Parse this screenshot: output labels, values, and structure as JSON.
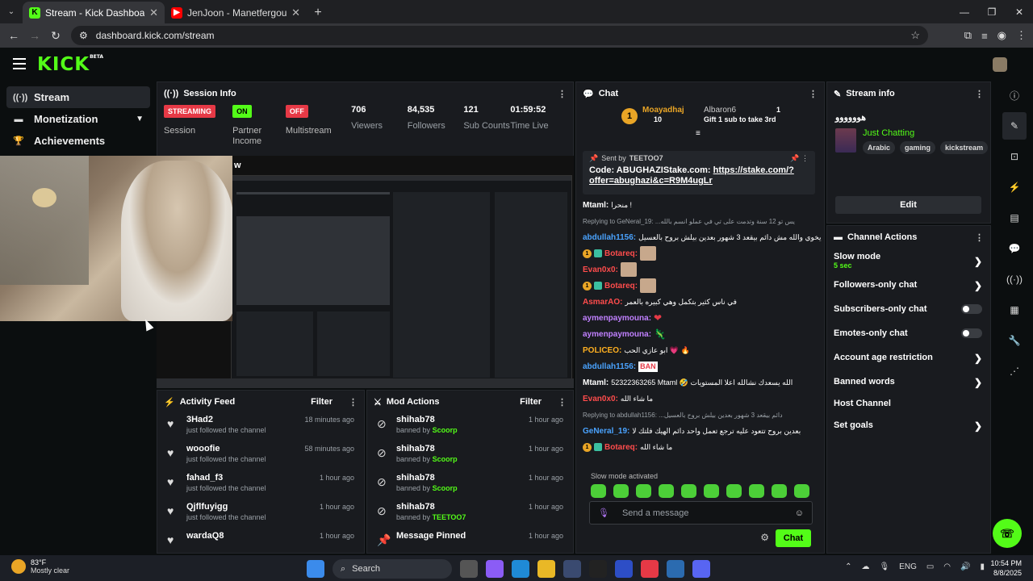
{
  "browser": {
    "tabs": [
      {
        "title": "Stream - Kick Dashboard",
        "favicon": "K"
      },
      {
        "title": "JenJoon - Manetfergou | ...",
        "favicon": "▶"
      }
    ],
    "url": "dashboard.kick.com/stream"
  },
  "kick": {
    "logo": "KICK",
    "logo_sup": "BETA"
  },
  "leftnav": [
    {
      "label": "Stream",
      "icon": "((·))"
    },
    {
      "label": "Monetization",
      "icon": "▬"
    },
    {
      "label": "Achievements",
      "icon": "🏆"
    }
  ],
  "session": {
    "title": "Session Info",
    "streaming_badge": "STREAMING",
    "streaming_label": "Session",
    "on_badge": "ON",
    "on_label": "Partner Income",
    "off_badge": "OFF",
    "off_label": "Multistream",
    "viewers": "706",
    "viewers_label": "Viewers",
    "followers": "84,535",
    "followers_label": "Followers",
    "subs": "121",
    "subs_label": "Sub Counts",
    "time": "01:59:52",
    "time_label": "Time Live",
    "preview_title": "w"
  },
  "activity": {
    "title": "Activity Feed",
    "filter": "Filter",
    "items": [
      {
        "name": "3Had2",
        "sub": "just followed the channel",
        "time": "18 minutes ago"
      },
      {
        "name": "wooofie",
        "sub": "just followed the channel",
        "time": "58 minutes ago"
      },
      {
        "name": "fahad_f3",
        "sub": "just followed the channel",
        "time": "1 hour ago"
      },
      {
        "name": "Qjflfuyigg",
        "sub": "just followed the channel",
        "time": "1 hour ago"
      },
      {
        "name": "wardaQ8",
        "sub": "",
        "time": "1 hour ago"
      }
    ]
  },
  "mod": {
    "title": "Mod Actions",
    "filter": "Filter",
    "items": [
      {
        "name": "shihab78",
        "pre": "banned by",
        "by": "Scoorp",
        "time": "1 hour ago"
      },
      {
        "name": "shihab78",
        "pre": "banned by",
        "by": "Scoorp",
        "time": "1 hour ago"
      },
      {
        "name": "shihab78",
        "pre": "banned by",
        "by": "Scoorp",
        "time": "1 hour ago"
      },
      {
        "name": "shihab78",
        "pre": "banned by",
        "by": "TEETOO7",
        "time": "1 hour ago"
      },
      {
        "name": "Message Pinned",
        "pre": "",
        "by": "",
        "time": "1 hour ago"
      }
    ]
  },
  "chat": {
    "title": "Chat",
    "top1_name": "Moayadhaj",
    "top1_count": "10",
    "top1_rank": "1",
    "top2_name": "Albaron6",
    "top2_count": "1",
    "top2_text": "Gift 1 sub to take 3rd",
    "pinned_by": "Sent by",
    "pinned_user": "TEETOO7",
    "pinned_code": "Code: ABUGHAZIStake.com: ",
    "pinned_link": "https://stake.com/?offer=abughazi&c=R9M4ugLr",
    "lines": [
      {
        "user": "Mtaml:",
        "ucolor": "#ffffff",
        "text": "منحرا !"
      },
      {
        "reply": "Replying to GeNeral_19: ...يس تو 12 سنة وتدمت على تي في عملو انسم بالله"
      },
      {
        "user": "abdullah1156:",
        "ucolor": "#4aa3ff",
        "text": "يخوي والله مش دائم بيقعد 3 شهور بعدين بيلش بروح بالعسيل"
      },
      {
        "user": "Botareq:",
        "ucolor": "#ff4c4c",
        "text": ""
      },
      {
        "user": "Evan0x0:",
        "ucolor": "#ff4c4c",
        "text": ""
      },
      {
        "user": "Botareq:",
        "ucolor": "#ff4c4c",
        "text": ""
      },
      {
        "user": "AsmarAO:",
        "ucolor": "#ff4c4c",
        "text": "في ناس كثير بتكمل وهي كبيره بالعمر"
      },
      {
        "user": "aymenpaymouna:",
        "ucolor": "#c080ff",
        "text": "❤"
      },
      {
        "user": "aymenpaymouna:",
        "ucolor": "#c080ff",
        "text": "🦎"
      },
      {
        "user": "POLICEO:",
        "ucolor": "#ffb020",
        "text": "ابو عازي الحب 💗 🔥"
      },
      {
        "user": "abdullah1156:",
        "ucolor": "#4aa3ff",
        "text": "BAN"
      },
      {
        "user": "Mtaml:",
        "ucolor": "#ffffff",
        "text": "52322363265 Mtaml 🤣 الله يسعدك نشالله اعلا المستويات"
      },
      {
        "user": "Evan0x0:",
        "ucolor": "#ff4c4c",
        "text": "ما شاء الله"
      },
      {
        "reply": "Replying to abdullah1156: ...دائم بيقعد 3 شهور بعدين بيلش بروح بالعسيل"
      },
      {
        "user": "GeNeral_19:",
        "ucolor": "#4aa3ff",
        "text": "بعدين بروح تتعود عليه ترجع تعمل واحد دائم الهيك فلتك لا"
      },
      {
        "user": "Botareq:",
        "ucolor": "#ff4c4c",
        "text": "ما شاء الله"
      }
    ],
    "slow_mode_text": "Slow mode activated",
    "input_placeholder": "Send a message",
    "send_label": "Chat"
  },
  "stream_info": {
    "title": "Stream info",
    "stream_title": "هوووووو",
    "category": "Just Chatting",
    "tags": [
      "Arabic",
      "gaming",
      "kickstream"
    ],
    "edit_label": "Edit"
  },
  "channel_actions": {
    "title": "Channel Actions",
    "items": [
      {
        "label": "Slow mode",
        "sub": "5 sec",
        "kind": "arrow"
      },
      {
        "label": "Followers-only chat",
        "sub": "",
        "kind": "arrow"
      },
      {
        "label": "Subscribers-only chat",
        "sub": "",
        "kind": "toggle"
      },
      {
        "label": "Emotes-only chat",
        "sub": "",
        "kind": "toggle"
      },
      {
        "label": "Account age restriction",
        "sub": "",
        "kind": "arrow"
      },
      {
        "label": "Banned words",
        "sub": "",
        "kind": "arrow"
      },
      {
        "label": "Host Channel",
        "sub": "",
        "kind": "none"
      },
      {
        "label": "Set goals",
        "sub": "",
        "kind": "arrow"
      }
    ]
  },
  "taskbar": {
    "temp": "83°F",
    "weather": "Mostly clear",
    "search": "Search",
    "lang": "ENG",
    "time": "10:54 PM",
    "date": "8/8/2025"
  },
  "colors": {
    "accent": "#53fc18",
    "red": "#e63946"
  }
}
